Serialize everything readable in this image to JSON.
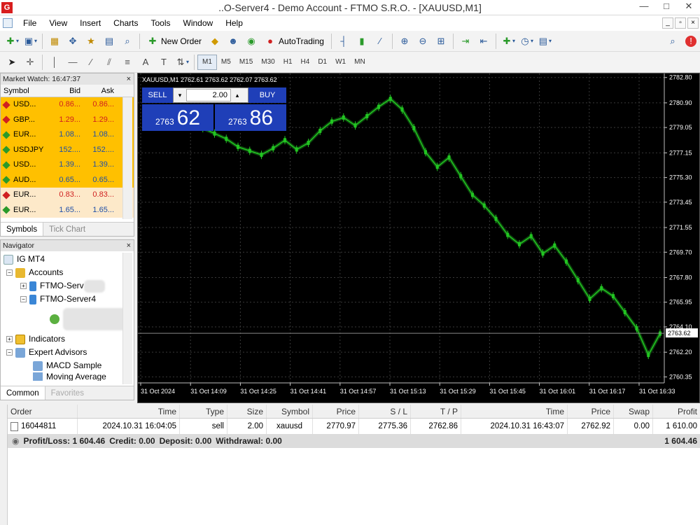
{
  "window": {
    "title": "..O-Server4 - Demo Account - FTMO S.R.O. - [XAUUSD,M1]",
    "app_icon_text": "G",
    "controls": {
      "minimize": "—",
      "maximize": "□",
      "close": "✕"
    }
  },
  "menu": {
    "items": [
      "File",
      "View",
      "Insert",
      "Charts",
      "Tools",
      "Window",
      "Help"
    ],
    "mdi_controls": [
      "_",
      "▫",
      "×"
    ]
  },
  "toolbar": {
    "new_order_label": "New Order",
    "autotrading_label": "AutoTrading",
    "timeframes": [
      "M1",
      "M5",
      "M15",
      "M30",
      "H1",
      "H4",
      "D1",
      "W1",
      "MN"
    ],
    "active_timeframe": "M1",
    "text_tool": "A"
  },
  "market_watch": {
    "title": "Market Watch: 16:47:37",
    "close": "×",
    "columns": {
      "symbol": "Symbol",
      "bid": "Bid",
      "ask": "Ask"
    },
    "rows": [
      {
        "symbol": "USD...",
        "bid": "0.86...",
        "ask": "0.86...",
        "bg": "#ffc000",
        "num_color": "#d02020",
        "dir": "down"
      },
      {
        "symbol": "GBP...",
        "bid": "1.29...",
        "ask": "1.29...",
        "bg": "#ffc000",
        "num_color": "#d02020",
        "dir": "down"
      },
      {
        "symbol": "EUR...",
        "bid": "1.08...",
        "ask": "1.08...",
        "bg": "#ffc000",
        "num_color": "#1f4fa8",
        "dir": "up"
      },
      {
        "symbol": "USDJPY",
        "bid": "152....",
        "ask": "152....",
        "bg": "#ffc000",
        "num_color": "#1f4fa8",
        "dir": "up"
      },
      {
        "symbol": "USD...",
        "bid": "1.39...",
        "ask": "1.39...",
        "bg": "#ffc000",
        "num_color": "#1f4fa8",
        "dir": "up"
      },
      {
        "symbol": "AUD...",
        "bid": "0.65...",
        "ask": "0.65...",
        "bg": "#ffc000",
        "num_color": "#1f4fa8",
        "dir": "up"
      },
      {
        "symbol": "EUR...",
        "bid": "0.83...",
        "ask": "0.83...",
        "bg": "#fde9c9",
        "num_color": "#d02020",
        "dir": "down"
      },
      {
        "symbol": "EUR...",
        "bid": "1.65...",
        "ask": "1.65...",
        "bg": "#fde9c9",
        "num_color": "#1f4fa8",
        "dir": "up"
      }
    ],
    "tabs": [
      "Symbols",
      "Tick Chart"
    ]
  },
  "navigator": {
    "title": "Navigator",
    "close": "×",
    "root": "IG MT4",
    "accounts": "Accounts",
    "server_1": "FTMO-Serv",
    "server_2": "FTMO-Server4",
    "indicators": "Indicators",
    "expert_advisors": "Expert Advisors",
    "ea_1": "MACD Sample",
    "ea_2": "Moving Average",
    "tabs": [
      "Common",
      "Favorites"
    ]
  },
  "chart_panel": {
    "header": "XAUUSD,M1  2762.61 2763.62 2762.07 2763.62",
    "sell_label": "SELL",
    "buy_label": "BUY",
    "lot": "2.00",
    "sell_small": "2763",
    "sell_big": "62",
    "buy_small": "2763",
    "buy_big": "86",
    "colors": {
      "background": "#000000",
      "grid": "#3a3a3a",
      "candle": "#22c422",
      "text": "#ffffff",
      "trade_panel": "#1f3fb8"
    }
  },
  "chart_data": {
    "type": "line",
    "title": "",
    "symbol": "XAUUSD",
    "timeframe": "M1",
    "ylim": [
      2759.9,
      2783.1
    ],
    "yticks": [
      "2782.80",
      "2780.90",
      "2779.05",
      "2777.15",
      "2775.30",
      "2773.45",
      "2771.55",
      "2769.70",
      "2767.80",
      "2765.95",
      "2764.10",
      "2762.20",
      "2760.35"
    ],
    "xticks": [
      "31 Oct 2024",
      "31 Oct 14:09",
      "31 Oct 14:25",
      "31 Oct 14:41",
      "31 Oct 14:57",
      "31 Oct 15:13",
      "31 Oct 15:29",
      "31 Oct 15:45",
      "31 Oct 16:01",
      "31 Oct 16:17",
      "31 Oct 16:33"
    ],
    "current_price_label": "2763.62",
    "current_price": 2763.62,
    "grid": true,
    "x": [
      0,
      1,
      2,
      3,
      4,
      5,
      6,
      7,
      8,
      9,
      10,
      11,
      12,
      13,
      14,
      15,
      16,
      17,
      18,
      19,
      20,
      21,
      22,
      23,
      24,
      25,
      26,
      27,
      28,
      29,
      30,
      31,
      32,
      33,
      34,
      35,
      36,
      37,
      38,
      39,
      40
    ],
    "series": [
      {
        "values": [
          2779.3,
          2779.0,
          2778.6,
          2778.2,
          2777.6,
          2777.3,
          2777.0,
          2777.5,
          2778.1,
          2777.4,
          2777.9,
          2778.8,
          2779.5,
          2779.8,
          2779.2,
          2779.9,
          2780.6,
          2781.2,
          2780.4,
          2779.0,
          2777.2,
          2776.1,
          2776.8,
          2775.4,
          2774.0,
          2773.2,
          2772.2,
          2771.0,
          2770.3,
          2770.9,
          2769.6,
          2770.2,
          2769.0,
          2767.6,
          2766.2,
          2767.0,
          2766.4,
          2765.2,
          2764.0,
          2762.0,
          2763.6
        ]
      }
    ]
  },
  "terminal": {
    "columns": [
      "Order",
      "Time",
      "Type",
      "Size",
      "Symbol",
      "Price",
      "S / L",
      "T / P",
      "Time",
      "Price",
      "Swap",
      "Profit"
    ],
    "order": {
      "order": "16044811",
      "time": "2024.10.31 16:04:05",
      "type": "sell",
      "size": "2.00",
      "symbol": "xauusd",
      "price": "2770.97",
      "sl": "2775.36",
      "tp": "2762.86",
      "close_time": "2024.10.31 16:43:07",
      "close_price": "2762.92",
      "swap": "0.00",
      "profit": "1 610.00"
    },
    "summary": {
      "profit_loss": "Profit/Loss: 1 604.46",
      "credit": "Credit: 0.00",
      "deposit": "Deposit: 0.00",
      "withdrawal": "Withdrawal: 0.00",
      "total": "1 604.46"
    }
  }
}
